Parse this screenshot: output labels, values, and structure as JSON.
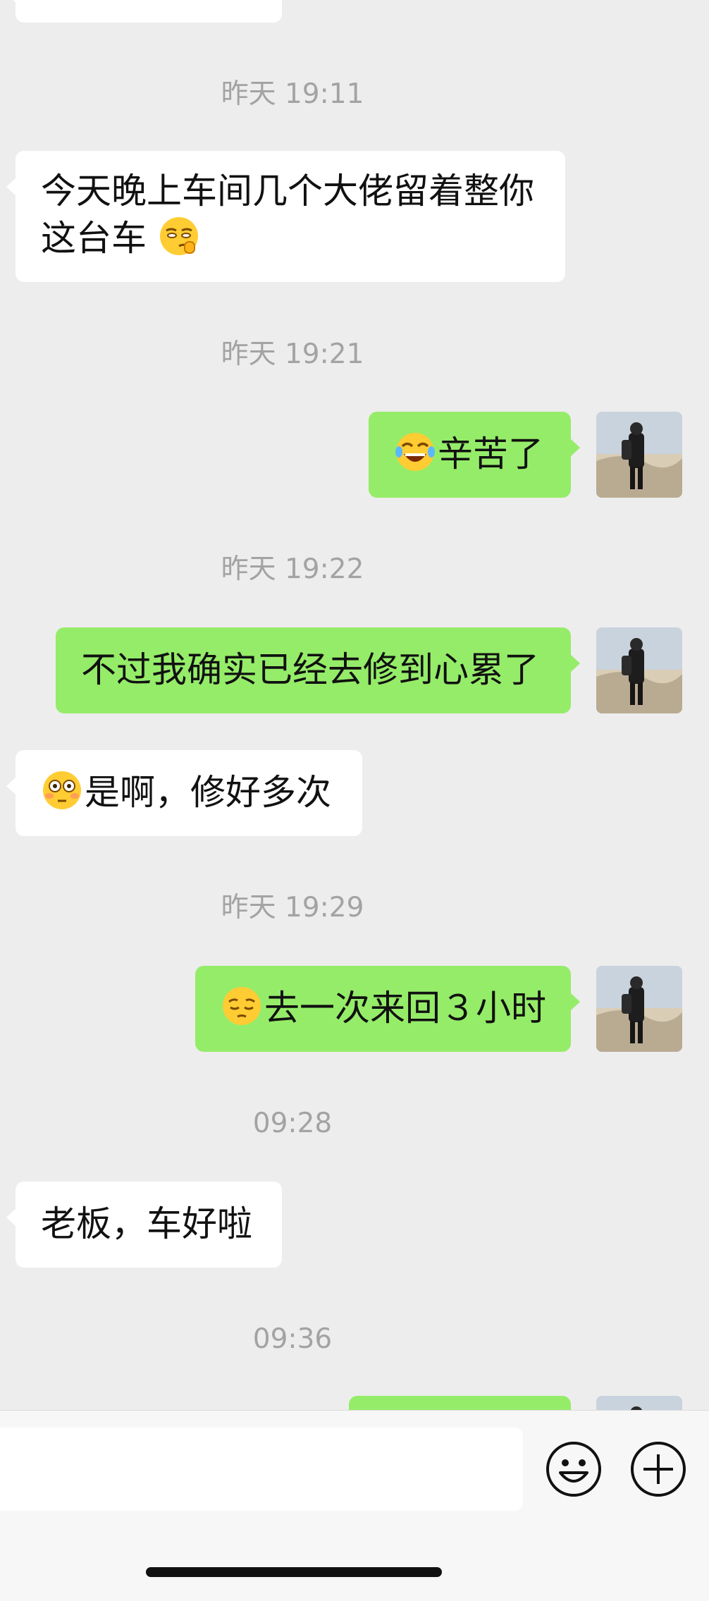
{
  "timestamps": [
    "昨天 19:11",
    "昨天 19:21",
    "昨天 19:22",
    "昨天 19:29",
    "09:28",
    "09:36"
  ],
  "messages": [
    {
      "side": "in",
      "text_line1": "今天晚上车间几个大佬留着整你",
      "text_line2": "这台车",
      "emoji": "smirk-hush-emoji"
    },
    {
      "side": "out",
      "text": "辛苦了",
      "emoji": "tears-of-joy-emoji"
    },
    {
      "side": "out",
      "text": "不过我确实已经去修到心累了"
    },
    {
      "side": "in",
      "text": "是啊，修好多次",
      "emoji": "flushed-emoji"
    },
    {
      "side": "out",
      "text": "去一次来回３小时",
      "emoji": "pensive-emoji"
    },
    {
      "side": "in",
      "text": "老板，车好啦"
    }
  ],
  "input": {
    "placeholder": ""
  },
  "colors": {
    "background": "#ededed",
    "incoming": "#ffffff",
    "outgoing": "#95ec69",
    "timestamp": "#a3a3a3"
  },
  "icons": [
    "emoji-icon",
    "plus-icon"
  ]
}
